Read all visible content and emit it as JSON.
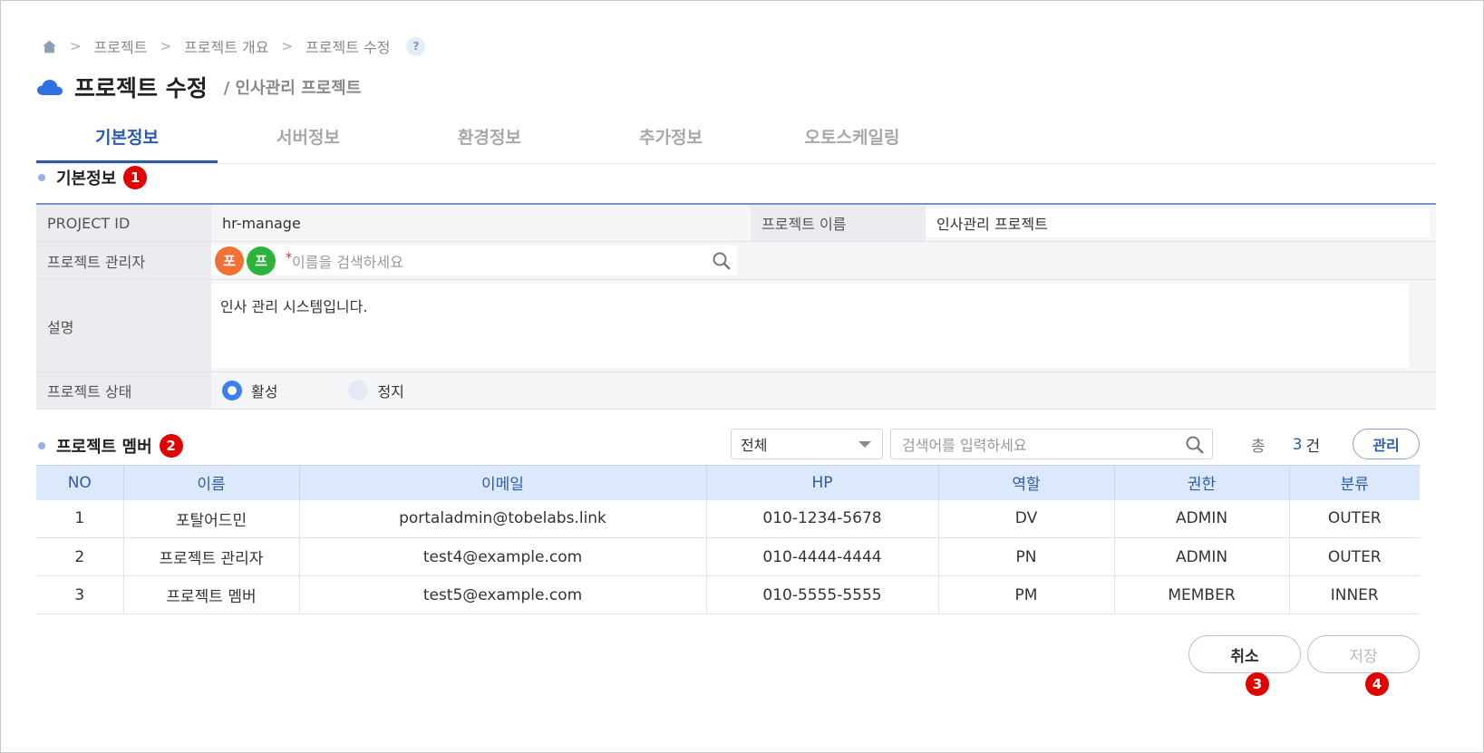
{
  "breadcrumb": {
    "items": [
      "프로젝트",
      "프로젝트 개요",
      "프로젝트 수정"
    ],
    "help": "?"
  },
  "header": {
    "title": "프로젝트 수정",
    "subtitle": "/ 인사관리 프로젝트"
  },
  "tabs": [
    {
      "label": "기본정보",
      "active": true
    },
    {
      "label": "서버정보"
    },
    {
      "label": "환경정보"
    },
    {
      "label": "추가정보"
    },
    {
      "label": "오토스케일링"
    }
  ],
  "basic_section": {
    "title": "기본정보",
    "badge": "1",
    "project_id_label": "PROJECT ID",
    "project_id_value": "hr-manage",
    "project_name_label": "프로젝트 이름",
    "project_name_value": "인사관리 프로젝트",
    "manager_label": "프로젝트 관리자",
    "manager_avatars": [
      {
        "text": "포",
        "color": "#f07035"
      },
      {
        "text": "프",
        "color": "#2db33b"
      }
    ],
    "manager_required": "*",
    "manager_placeholder": "이름을 검색하세요",
    "description_label": "설명",
    "description_value": "인사 관리 시스템입니다.",
    "status_label": "프로젝트 상태",
    "status_active": "활성",
    "status_stop": "정지"
  },
  "member_section": {
    "title": "프로젝트 멤버",
    "badge": "2",
    "filter_value": "전체",
    "search_placeholder": "검색어를 입력하세요",
    "total_label": "총",
    "total_count": "3",
    "total_unit": "건",
    "manage_label": "관리",
    "columns": [
      "NO",
      "이름",
      "이메일",
      "HP",
      "역할",
      "권한",
      "분류"
    ],
    "rows": [
      [
        "1",
        "포탈어드민",
        "portaladmin@tobelabs.link",
        "010-1234-5678",
        "DV",
        "ADMIN",
        "OUTER"
      ],
      [
        "2",
        "프로젝트 관리자",
        "test4@example.com",
        "010-4444-4444",
        "PN",
        "ADMIN",
        "OUTER"
      ],
      [
        "3",
        "프로젝트 멤버",
        "test5@example.com",
        "010-5555-5555",
        "PM",
        "MEMBER",
        "INNER"
      ]
    ]
  },
  "actions": {
    "cancel_label": "취소",
    "cancel_badge": "3",
    "save_label": "저장",
    "save_badge": "4"
  },
  "colors": {
    "accent": "#2c5ca8",
    "badge": "#e00000",
    "radio_on": "#3b80ee"
  }
}
